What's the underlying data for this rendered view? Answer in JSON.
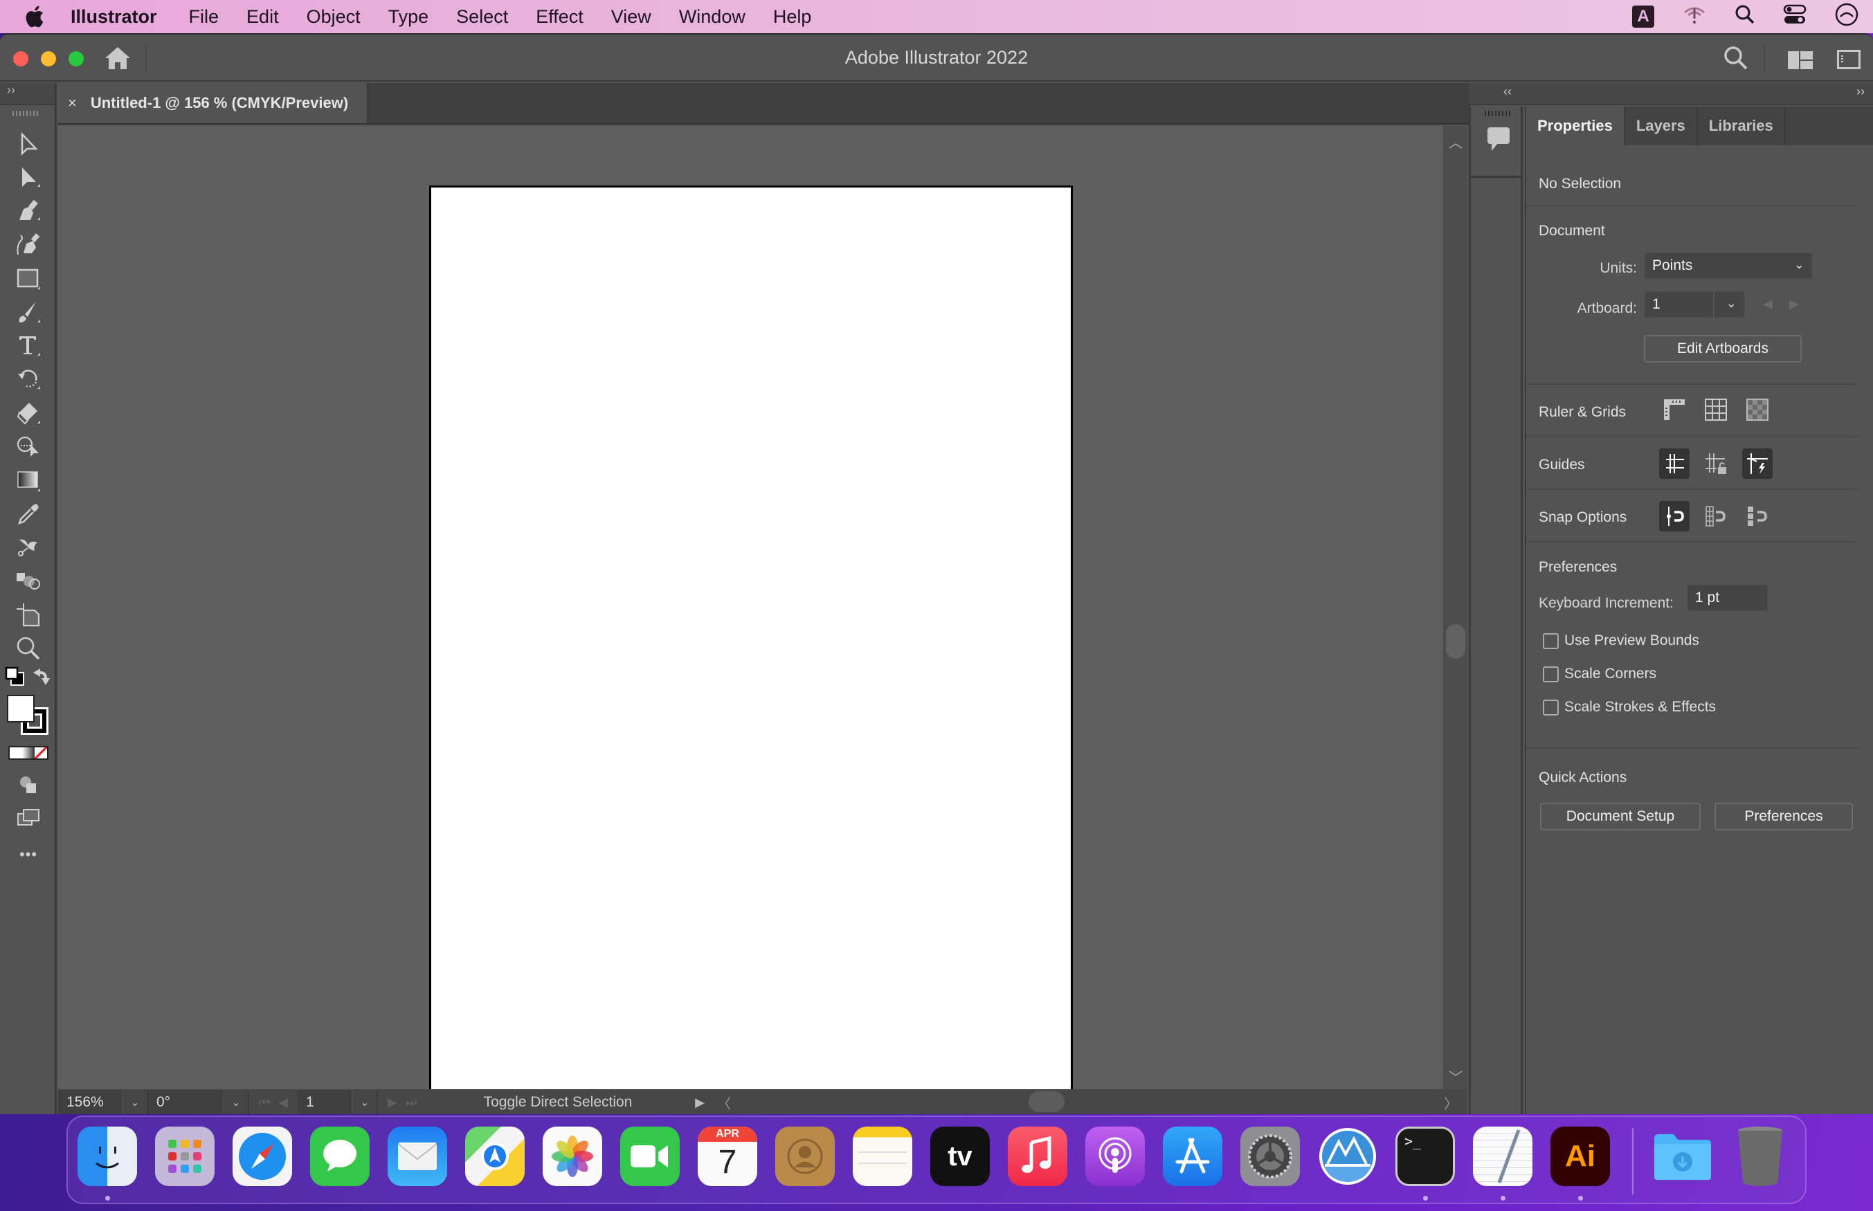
{
  "menubar": {
    "app_name": "Illustrator",
    "items": [
      "File",
      "Edit",
      "Object",
      "Type",
      "Select",
      "Effect",
      "View",
      "Window",
      "Help"
    ],
    "status_icons": [
      "keyboard-input-a-icon",
      "wifi-alert-icon",
      "spotlight-search-icon",
      "control-center-icon",
      "siri-icon"
    ],
    "input_source_label": "A"
  },
  "window": {
    "title": "Adobe Illustrator 2022"
  },
  "document_tab": {
    "close_label": "×",
    "title": "Untitled-1 @ 156 % (CMYK/Preview)"
  },
  "toolbar": {
    "collapse_label": "››",
    "tools": [
      "selection-tool",
      "direct-selection-tool",
      "pen-tool",
      "curvature-tool",
      "rectangle-tool",
      "paintbrush-tool",
      "type-tool",
      "rotate-tool",
      "eraser-tool",
      "shape-builder-tool",
      "gradient-tool",
      "eyedropper-tool",
      "puppet-warp-tool",
      "blend-tool",
      "artboard-tool",
      "zoom-tool"
    ],
    "fill_color": "#ffffff",
    "stroke_color": "#000000",
    "more_label": "•••"
  },
  "statusbar": {
    "zoom": "156%",
    "rotation": "0°",
    "artboard_number": "1",
    "message": "Toggle Direct Selection"
  },
  "right_dock": {
    "collapse_left_label": "‹‹",
    "collapse_right_label": "››"
  },
  "panel": {
    "tabs": [
      {
        "label": "Properties",
        "active": true
      },
      {
        "label": "Layers",
        "active": false
      },
      {
        "label": "Libraries",
        "active": false
      }
    ],
    "selection_status": "No Selection",
    "document": {
      "heading": "Document",
      "units_label": "Units:",
      "units_value": "Points",
      "artboard_label": "Artboard:",
      "artboard_value": "1",
      "edit_artboards_label": "Edit Artboards"
    },
    "ruler_grids": {
      "label": "Ruler & Grids",
      "icons": [
        "rulers-icon",
        "grid-icon",
        "transparency-grid-icon"
      ]
    },
    "guides": {
      "label": "Guides",
      "icons": [
        {
          "name": "show-guides-icon",
          "active": true
        },
        {
          "name": "lock-guides-icon",
          "active": false
        },
        {
          "name": "smart-guides-icon",
          "active": true
        }
      ]
    },
    "snap_options": {
      "label": "Snap Options",
      "icons": [
        {
          "name": "snap-to-point-icon",
          "active": true
        },
        {
          "name": "snap-to-pixel-icon",
          "active": false
        },
        {
          "name": "snap-to-glyph-icon",
          "active": false
        }
      ]
    },
    "preferences": {
      "heading": "Preferences",
      "keyboard_increment_label": "Keyboard Increment:",
      "keyboard_increment_value": "1 pt",
      "checkboxes": [
        {
          "label": "Use Preview Bounds",
          "checked": false
        },
        {
          "label": "Scale Corners",
          "checked": false
        },
        {
          "label": "Scale Strokes & Effects",
          "checked": false
        }
      ]
    },
    "quick_actions": {
      "heading": "Quick Actions",
      "document_setup_label": "Document Setup",
      "preferences_label": "Preferences"
    }
  },
  "dock": {
    "apps": [
      {
        "name": "Finder",
        "running": true
      },
      {
        "name": "Launchpad",
        "running": false
      },
      {
        "name": "Safari",
        "running": false
      },
      {
        "name": "Messages",
        "running": false
      },
      {
        "name": "Mail",
        "running": false
      },
      {
        "name": "Maps",
        "running": false
      },
      {
        "name": "Photos",
        "running": false
      },
      {
        "name": "FaceTime",
        "running": false
      },
      {
        "name": "Calendar",
        "running": false
      },
      {
        "name": "Contacts",
        "running": false
      },
      {
        "name": "Notes",
        "running": false
      },
      {
        "name": "Apple TV",
        "running": false
      },
      {
        "name": "Music",
        "running": false
      },
      {
        "name": "Podcasts",
        "running": false
      },
      {
        "name": "App Store",
        "running": false
      },
      {
        "name": "System Preferences",
        "running": false
      },
      {
        "name": "Codepoint",
        "running": false
      },
      {
        "name": "Terminal",
        "running": true
      },
      {
        "name": "TextEdit",
        "running": true
      },
      {
        "name": "Adobe Illustrator",
        "running": true
      },
      {
        "name": "Downloads",
        "running": false
      },
      {
        "name": "Trash",
        "running": false
      }
    ],
    "calendar_month": "APR",
    "calendar_day": "7",
    "tv_label": "tv",
    "ai_label": "Ai"
  }
}
